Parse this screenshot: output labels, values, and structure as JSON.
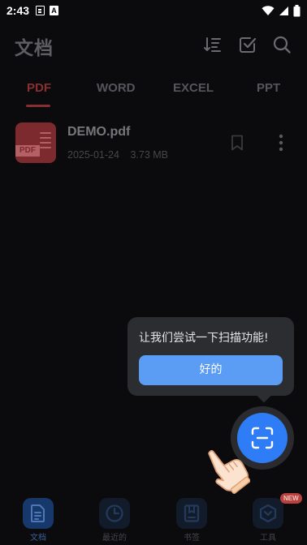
{
  "status_bar": {
    "time": "2:43",
    "a_label": "A"
  },
  "header": {
    "title": "文档",
    "icons": [
      "sort-icon",
      "select-check-icon",
      "search-icon"
    ]
  },
  "tabs": [
    {
      "label": "PDF",
      "active": true
    },
    {
      "label": "WORD",
      "active": false
    },
    {
      "label": "EXCEL",
      "active": false
    },
    {
      "label": "PPT",
      "active": false
    }
  ],
  "files": [
    {
      "name": "DEMO.pdf",
      "date": "2025-01-24",
      "size": "3.73 MB",
      "thumb_tag": "PDF"
    }
  ],
  "tooltip": {
    "message": "让我们尝试一下扫描功能!",
    "confirm_label": "好的"
  },
  "fab": {
    "icon": "scan-icon"
  },
  "bottom_nav": [
    {
      "label": "文档",
      "icon": "document-icon",
      "active": true
    },
    {
      "label": "最近的",
      "icon": "clock-icon",
      "active": false
    },
    {
      "label": "书签",
      "icon": "bookmark-icon",
      "active": false
    },
    {
      "label": "工具",
      "icon": "tools-icon",
      "active": false,
      "badge": "NEW"
    }
  ],
  "colors": {
    "background": "#0b0b0d",
    "accent_red": "#8a2e30",
    "fab_blue": "#2f7df6",
    "tooltip_button": "#5b9cf5"
  }
}
